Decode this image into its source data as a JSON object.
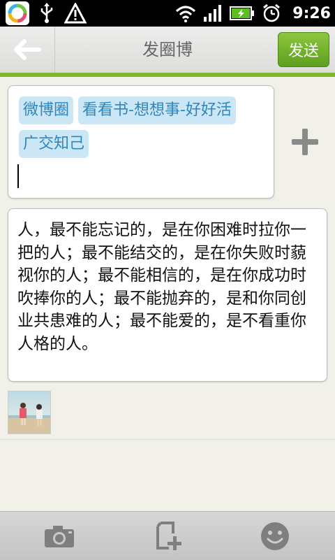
{
  "status_bar": {
    "time": "9:26",
    "icons": [
      "app-badge-icon",
      "usb-icon",
      "warning-icon",
      "wifi-icon",
      "signal-icon",
      "battery-icon",
      "alarm-icon"
    ]
  },
  "header": {
    "back_icon": "back-arrow-icon",
    "title": "发圈博",
    "send_label": "发送"
  },
  "topics": {
    "tags": [
      "微博圈",
      "看看书-想想事-好好活",
      "广交知己"
    ],
    "add_icon": "plus-icon"
  },
  "compose": {
    "text": "人，最不能忘记的，是在你困难时拉你一把的人；最不能结交的，是在你失败时藐视你的人；最不能相信的，是在你成功时吹捧你的人；最不能抛弃的，是和你同创业共患难的人；最不能爱的，是不看重你人格的人。"
  },
  "attachment": {
    "icon": "photo-thumbnail"
  },
  "toolbar": {
    "icons": [
      "camera-icon",
      "add-page-icon",
      "emoji-icon"
    ]
  },
  "colors": {
    "accent_green": "#7cb72c",
    "tag_bg": "#cbe6f4",
    "tag_text": "#2f86bd"
  }
}
